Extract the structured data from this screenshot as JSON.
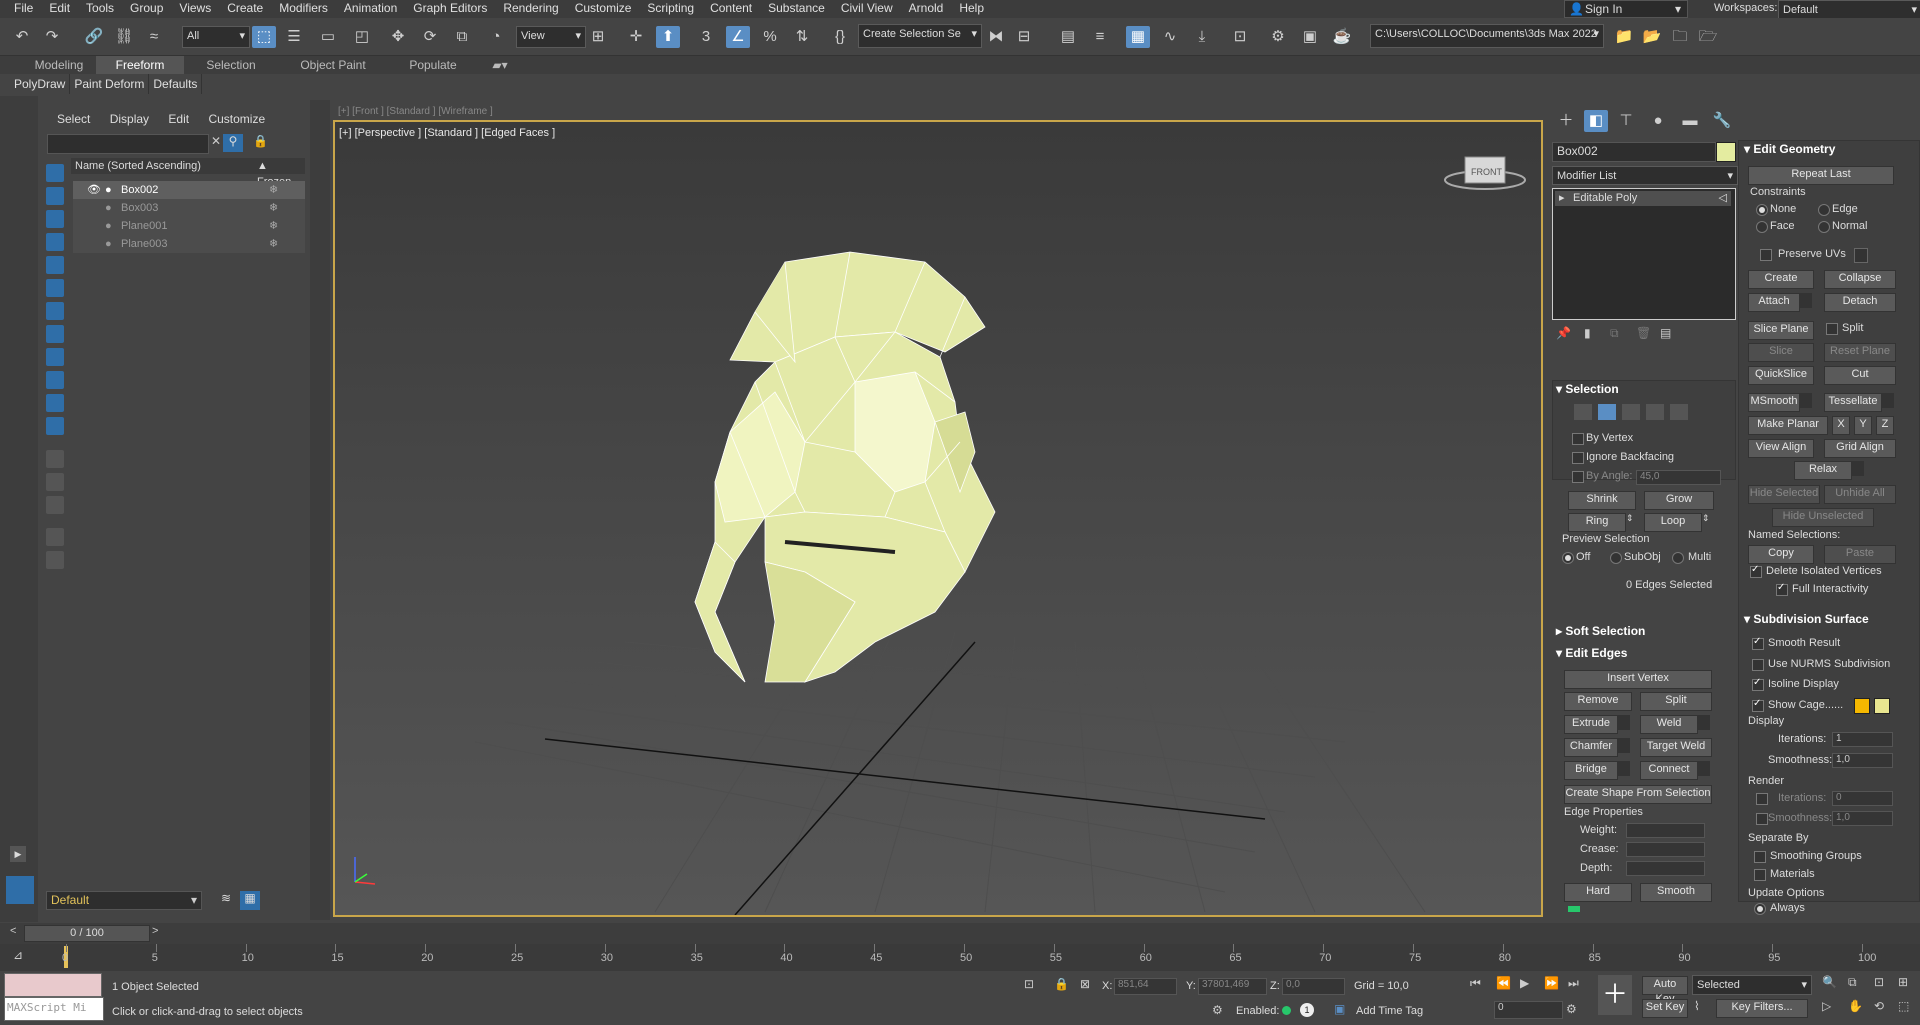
{
  "menus": [
    "File",
    "Edit",
    "Tools",
    "Group",
    "Views",
    "Create",
    "Modifiers",
    "Animation",
    "Graph Editors",
    "Rendering",
    "Customize",
    "Scripting",
    "Content",
    "Substance",
    "Civil View",
    "Arnold",
    "Help"
  ],
  "account": {
    "sign_in": "Sign In",
    "workspaces_label": "Workspaces:",
    "workspace_value": "Default"
  },
  "toolbar": {
    "filter_value": "All",
    "ref_coord_value": "View",
    "named_sel_value": "Create Selection Se",
    "project_path": "C:\\Users\\COLLOC\\Documents\\3ds Max 2022"
  },
  "ribbon_tabs": [
    "Modeling",
    "Freeform",
    "Selection",
    "Object Paint",
    "Populate"
  ],
  "sub_ribbon": [
    "PolyDraw",
    "Paint Deform",
    "Defaults"
  ],
  "scene_explorer": {
    "menu": [
      "Select",
      "Display",
      "Edit",
      "Customize"
    ],
    "col_name": "Name (Sorted Ascending)",
    "col_frozen": "▲ Frozen",
    "items": [
      "Box002",
      "Box003",
      "Plane001",
      "Plane003"
    ],
    "layer_value": "Default"
  },
  "viewport": {
    "label": "[+] [Perspective ] [Standard ] [Edged Faces ]",
    "back_label": "[+] [Front ] [Standard ] [Wireframe ]",
    "cube_label": "FRONT"
  },
  "command_panel": {
    "object_name": "Box002",
    "object_color": "#e4eca0",
    "modifier_list": "Modifier List",
    "stack_item": "Editable Poly",
    "selection": {
      "title": "Selection",
      "by_vertex": "By Vertex",
      "ignore_backfacing": "Ignore Backfacing",
      "by_angle": "By Angle:",
      "by_angle_value": "45,0",
      "shrink": "Shrink",
      "grow": "Grow",
      "ring": "Ring",
      "loop": "Loop",
      "preview_title": "Preview Selection",
      "off": "Off",
      "subobj": "SubObj",
      "multi": "Multi",
      "status": "0 Edges Selected"
    },
    "soft_selection": "Soft Selection",
    "edit_edges": {
      "title": "Edit Edges",
      "insert_vertex": "Insert Vertex",
      "remove": "Remove",
      "split": "Split",
      "extrude": "Extrude",
      "weld": "Weld",
      "chamfer": "Chamfer",
      "target_weld": "Target Weld",
      "bridge": "Bridge",
      "connect": "Connect",
      "create_shape": "Create Shape From Selection",
      "edge_props": "Edge Properties",
      "weight": "Weight:",
      "crease": "Crease:",
      "depth": "Depth:",
      "hard": "Hard",
      "smooth": "Smooth"
    },
    "edit_geometry": {
      "title": "Edit Geometry",
      "repeat_last": "Repeat Last",
      "constraints": "Constraints",
      "none": "None",
      "edge": "Edge",
      "face": "Face",
      "normal": "Normal",
      "preserve_uvs": "Preserve UVs",
      "create": "Create",
      "collapse": "Collapse",
      "attach": "Attach",
      "detach": "Detach",
      "slice_plane": "Slice Plane",
      "split": "Split",
      "slice": "Slice",
      "reset_plane": "Reset Plane",
      "quickslice": "QuickSlice",
      "cut": "Cut",
      "msmooth": "MSmooth",
      "tessellate": "Tessellate",
      "make_planar": "Make Planar",
      "x": "X",
      "y": "Y",
      "z": "Z",
      "view_align": "View Align",
      "grid_align": "Grid Align",
      "relax": "Relax",
      "hide_selected": "Hide Selected",
      "unhide_all": "Unhide All",
      "hide_unselected": "Hide Unselected",
      "named_selections": "Named Selections:",
      "copy": "Copy",
      "paste": "Paste",
      "delete_isolated": "Delete Isolated Vertices",
      "full_interactivity": "Full Interactivity"
    },
    "subdivision": {
      "title": "Subdivision Surface",
      "smooth_result": "Smooth Result",
      "use_nurms": "Use NURMS Subdivision",
      "isoline": "Isoline Display",
      "show_cage": "Show Cage......",
      "display": "Display",
      "iterations": "Iterations:",
      "iterations_value": "1",
      "smoothness": "Smoothness:",
      "smoothness_value": "1,0",
      "render": "Render",
      "r_iterations_value": "0",
      "r_smoothness_value": "1,0",
      "separate_by": "Separate By",
      "smoothing_groups": "Smoothing Groups",
      "materials": "Materials",
      "update_options": "Update Options",
      "always": "Always"
    }
  },
  "timeline": {
    "frame_counter": "0 / 100",
    "ticks": [
      "0",
      "5",
      "10",
      "15",
      "20",
      "25",
      "30",
      "35",
      "40",
      "45",
      "50",
      "55",
      "60",
      "65",
      "70",
      "75",
      "80",
      "85",
      "90",
      "95",
      "100"
    ]
  },
  "status": {
    "maxscript": "MAXScript Mi",
    "objects_selected": "1 Object Selected",
    "prompt": "Click or click-and-drag to select objects",
    "x_label": "X:",
    "x_value": "851,64",
    "y_label": "Y:",
    "y_value": "37801,469",
    "z_label": "Z:",
    "z_value": "0,0",
    "grid": "Grid = 10,0",
    "enabled": "Enabled:",
    "add_time_tag": "Add Time Tag",
    "auto_key": "Auto Key",
    "set_key": "Set Key",
    "key_mode_value": "Selected",
    "key_filters": "Key Filters...",
    "current_frame": "0"
  }
}
